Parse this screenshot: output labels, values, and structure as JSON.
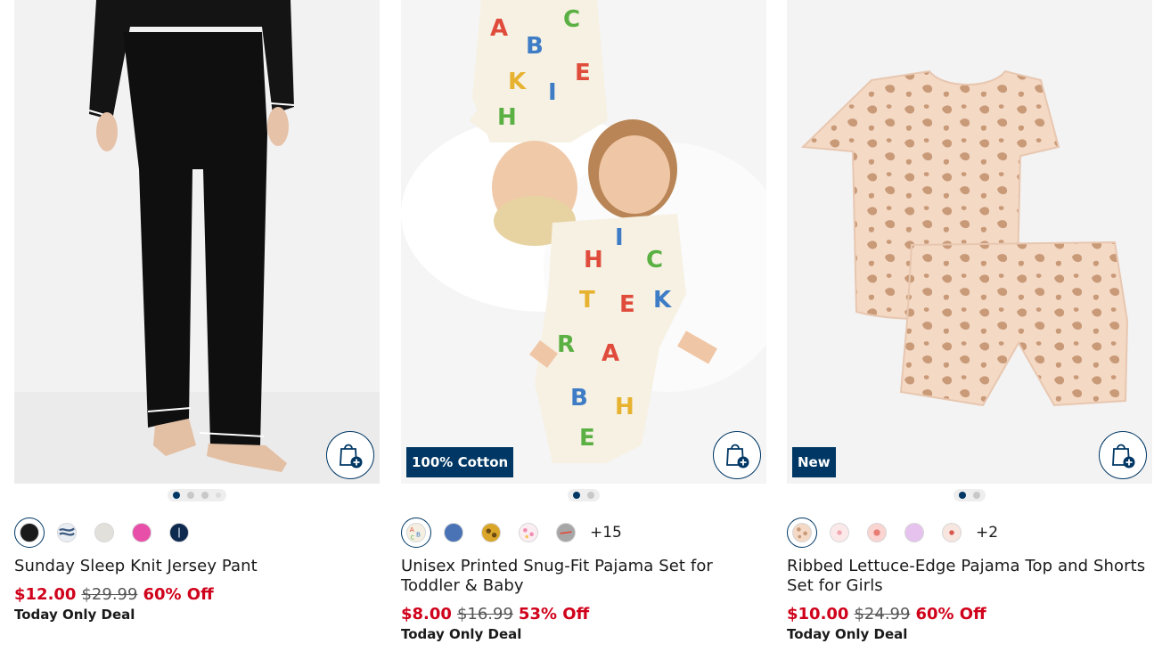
{
  "colors": {
    "navy": "#003764",
    "sale_red": "#d0021b"
  },
  "products": [
    {
      "title": "Sunday Sleep Knit Jersey Pant",
      "price_now": "$12.00",
      "price_was": "$29.99",
      "discount": "60% Off",
      "deal": "Today Only Deal",
      "badge": "",
      "image_slides": 4,
      "active_slide": 1,
      "swatches": [
        "#1a1a1a",
        "#8aa0b8",
        "#e2e0db",
        "#e84fa8",
        "#0e2a4f"
      ],
      "selected_swatch": 1,
      "more_colors": ""
    },
    {
      "title": "Unisex Printed Snug-Fit Pajama Set for Toddler & Baby",
      "price_now": "$8.00",
      "price_was": "$16.99",
      "discount": "53% Off",
      "deal": "Today Only Deal",
      "badge": "100% Cotton",
      "image_slides": 2,
      "active_slide": 1,
      "swatches": [
        "#f4efe0",
        "#4a73b5",
        "#d9a62a",
        "#f6d9e2",
        "#a7a7a7"
      ],
      "selected_swatch": 1,
      "more_colors": "+15"
    },
    {
      "title": "Ribbed Lettuce-Edge Pajama Top and Shorts Set for Girls",
      "price_now": "$10.00",
      "price_was": "$24.99",
      "discount": "60% Off",
      "deal": "Today Only Deal",
      "badge": "New",
      "image_slides": 2,
      "active_slide": 1,
      "swatches": [
        "#f3d9c6",
        "#f8d7d9",
        "#f5b9b3",
        "#e6c3ee",
        "#f1ddd3"
      ],
      "selected_swatch": 1,
      "more_colors": "+2"
    }
  ]
}
